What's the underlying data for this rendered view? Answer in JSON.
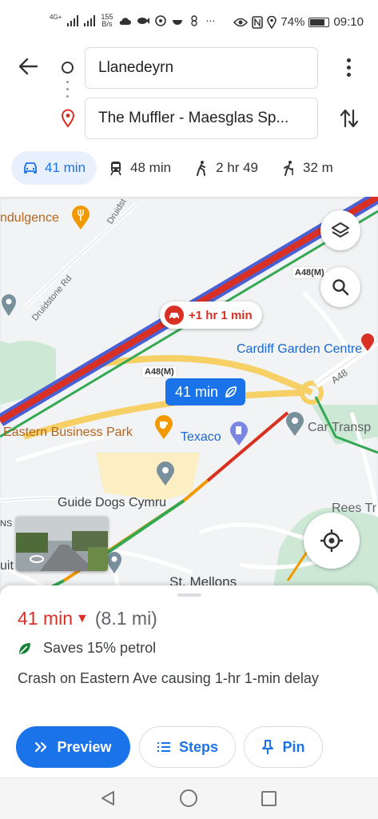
{
  "status_bar": {
    "network_label": "4G+",
    "speed_value": "155",
    "speed_unit": "B/s",
    "extra_icons": "⋯",
    "battery": "74%",
    "time": "09:10"
  },
  "route": {
    "origin": "Llanedeyrn",
    "destination": "The Muffler - Maesglas Sp..."
  },
  "modes": [
    {
      "label": "41 min",
      "icon": "car-icon",
      "active": true
    },
    {
      "label": "48 min",
      "icon": "train-icon"
    },
    {
      "label": "2 hr 49",
      "icon": "walk-icon"
    },
    {
      "label": "32 m",
      "icon": "ride-icon"
    }
  ],
  "map": {
    "labels": {
      "indulgence": "ndulgence",
      "druidstone_rd": "Druidstone Rd",
      "druidst": "Druidst",
      "a48m_top": "A48(M)",
      "a48m_mid": "A48(M)",
      "a48_right": "A48",
      "cardiff_garden": "Cardiff Garden Centre",
      "eastern_business": "Eastern Business Park",
      "texaco": "Texaco",
      "car_transp": "Car Transp",
      "guide_dogs": "Guide Dogs Cymru",
      "rees": "Rees Tr",
      "st_mellons": "St. Mellons",
      "ns": "NS",
      "uit": "uit"
    },
    "delay_bubble": "+1 hr 1 min",
    "route_bubble": "41 min"
  },
  "summary": {
    "eta": "41 min",
    "distance": "(8.1 mi)",
    "eco": "Saves 15% petrol",
    "description": "Crash on Eastern Ave causing 1-hr 1-min delay"
  },
  "actions": {
    "preview": "Preview",
    "steps": "Steps",
    "pin": "Pin"
  },
  "colors": {
    "accent": "#1a73e8",
    "traffic_red": "#d93025",
    "eco_green": "#188038"
  }
}
